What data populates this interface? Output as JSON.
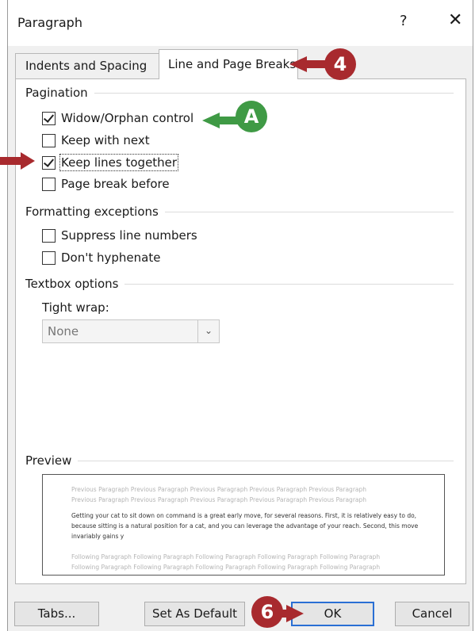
{
  "dialog": {
    "title": "Paragraph",
    "help": "?",
    "close": "✕"
  },
  "tabs": [
    {
      "label": "Indents and Spacing",
      "active": false
    },
    {
      "label": "Line and Page Breaks",
      "active": true
    }
  ],
  "pagination": {
    "label": "Pagination",
    "options": [
      {
        "label": "Widow/Orphan control",
        "checked": true
      },
      {
        "label": "Keep with next",
        "checked": false
      },
      {
        "label": "Keep lines together",
        "checked": true
      },
      {
        "label": "Page break before",
        "checked": false
      }
    ]
  },
  "formatting": {
    "label": "Formatting exceptions",
    "options": [
      {
        "label": "Suppress line numbers",
        "checked": false
      },
      {
        "label": "Don't hyphenate",
        "checked": false
      }
    ]
  },
  "textbox": {
    "label": "Textbox options",
    "tight_wrap_label": "Tight wrap:",
    "tight_wrap_value": "None"
  },
  "preview": {
    "label": "Preview",
    "previous": "Previous Paragraph Previous Paragraph Previous Paragraph Previous Paragraph Previous Paragraph",
    "previous2": "Previous Paragraph Previous Paragraph Previous Paragraph Previous Paragraph Previous Paragraph",
    "current": "Getting your cat to sit down on command is a great early move, for several reasons. First, it is relatively easy to do, because sitting is a natural position for a cat, and you can leverage the advantage of your reach. Second, this move invariably gains y",
    "following": "Following Paragraph Following Paragraph Following Paragraph Following Paragraph Following Paragraph",
    "following2": "Following Paragraph Following Paragraph Following Paragraph Following Paragraph Following Paragraph"
  },
  "buttons": {
    "tabs": "Tabs...",
    "set_default": "Set As Default",
    "ok": "OK",
    "cancel": "Cancel"
  },
  "callouts": {
    "four": "4",
    "a": "A",
    "six": "6"
  },
  "colors": {
    "callout_red": "#a82a2e",
    "callout_green": "#3f9a45",
    "default_button_border": "#2a6fd4"
  }
}
